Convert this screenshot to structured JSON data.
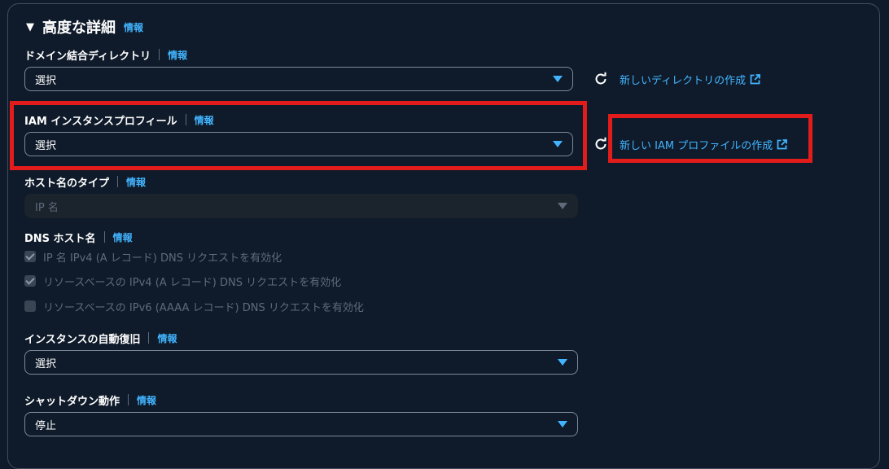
{
  "section": {
    "title": "高度な詳細",
    "info": "情報"
  },
  "directory": {
    "label": "ドメイン結合ディレクトリ",
    "info": "情報",
    "value": "選択",
    "create_link": "新しいディレクトリの作成"
  },
  "iam": {
    "label": "IAM インスタンスプロフィール",
    "info": "情報",
    "value": "選択",
    "create_link": "新しい IAM プロファイルの作成"
  },
  "hostname_type": {
    "label": "ホスト名のタイプ",
    "info": "情報",
    "value": "IP 名"
  },
  "dns_hostname": {
    "label": "DNS ホスト名",
    "info": "情報",
    "options": [
      {
        "text": "IP 名 IPv4 (A レコード) DNS リクエストを有効化",
        "checked": true
      },
      {
        "text": "リソースベースの IPv4 (A レコード) DNS リクエストを有効化",
        "checked": true
      },
      {
        "text": "リソースベースの IPv6 (AAAA レコード) DNS リクエストを有効化",
        "checked": false
      }
    ]
  },
  "auto_recovery": {
    "label": "インスタンスの自動復旧",
    "info": "情報",
    "value": "選択"
  },
  "shutdown": {
    "label": "シャットダウン動作",
    "info": "情報",
    "value": "停止"
  },
  "colors": {
    "link": "#42b4ff",
    "highlight": "#e21b1b",
    "background": "#0f1b2a"
  },
  "icons": [
    "caret-down-icon",
    "chevron-down-icon",
    "refresh-icon",
    "external-link-icon",
    "checkbox-icon"
  ]
}
